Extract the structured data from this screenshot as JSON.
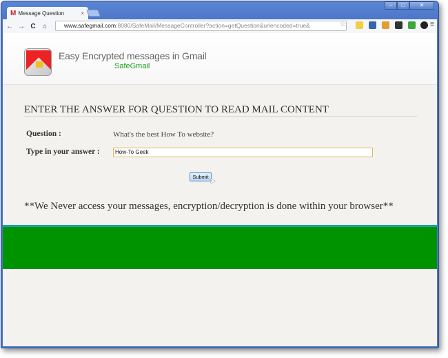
{
  "browser": {
    "tab_title": "Message Question",
    "url_host": "www.safegmail.com",
    "url_rest": ":8080/SafeMail/MessageController?action=getQuestion&urlencoded=true&"
  },
  "header": {
    "title": "Easy Encrypted messages in Gmail",
    "brand": "SafeGmail"
  },
  "form": {
    "heading": "ENTER THE ANSWER FOR QUESTION TO READ MAIL CONTENT",
    "question_label": "Question :",
    "question_value": "What's the best How To website?",
    "answer_label": "Type in your answer :",
    "answer_value": "How-To Geek",
    "submit_label": "Submit"
  },
  "note": "**We Never access your messages, encryption/decryption is done within your browser**",
  "colors": {
    "band": "#009300",
    "brand": "#1aa01a"
  }
}
